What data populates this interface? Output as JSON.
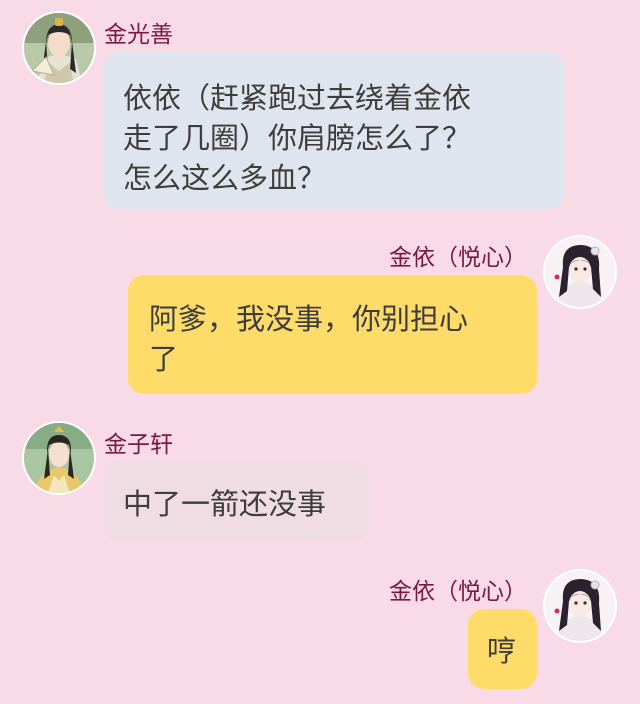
{
  "conversation": [
    {
      "side": "left",
      "name": "金光善",
      "avatar": "elder-man-avatar-icon",
      "bubble_color": "#dfe4ee",
      "lines": [
        "依依（赶紧跑过去绕着金依",
        "走了几圈）你肩膀怎么了？",
        "怎么这么多血？"
      ]
    },
    {
      "side": "right",
      "name": "金依（悦心）",
      "avatar": "girl-avatar-icon",
      "bubble_color": "#ffdc6a",
      "lines": [
        "阿爹，我没事，你别担心",
        "了"
      ]
    },
    {
      "side": "left",
      "name": "金子轩",
      "avatar": "young-man-avatar-icon",
      "bubble_color": "#efdde3",
      "lines": [
        "中了一箭还没事"
      ]
    },
    {
      "side": "right",
      "name": "金依（悦心）",
      "avatar": "girl-avatar-icon",
      "bubble_color": "#ffdc6a",
      "lines": [
        "哼"
      ]
    }
  ],
  "colors": {
    "background": "#f8dbe6",
    "name_text": "#7a1a3c",
    "message_text": "#3d3d3d"
  }
}
